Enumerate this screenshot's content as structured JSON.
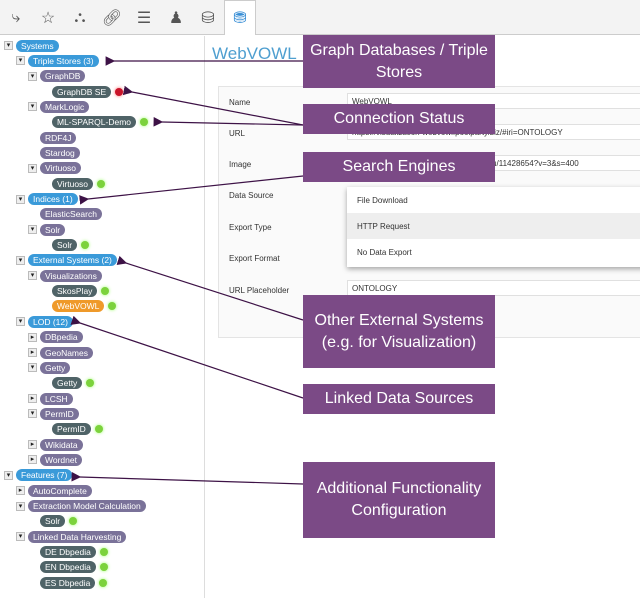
{
  "toolbar": {
    "icons": [
      "hierarchy-icon",
      "document-star-icon",
      "sitemap-icon",
      "link-icon",
      "list-icon",
      "user-settings-icon",
      "database-icon",
      "database-active-icon"
    ]
  },
  "tree": [
    {
      "label": "Systems",
      "level": 0,
      "color": "blue",
      "toggle": "open"
    },
    {
      "label": "Triple Stores (3)",
      "level": 1,
      "color": "blue",
      "toggle": "open"
    },
    {
      "label": "GraphDB",
      "level": 2,
      "color": "purple",
      "toggle": "open"
    },
    {
      "label": "GraphDB SE",
      "level": 3,
      "color": "dark",
      "status": "red"
    },
    {
      "label": "MarkLogic",
      "level": 2,
      "color": "purple",
      "toggle": "open"
    },
    {
      "label": "ML-SPARQL-Demo",
      "level": 3,
      "color": "dark",
      "status": "green"
    },
    {
      "label": "RDF4J",
      "level": 2,
      "color": "purple"
    },
    {
      "label": "Stardog",
      "level": 2,
      "color": "purple"
    },
    {
      "label": "Virtuoso",
      "level": 2,
      "color": "purple",
      "toggle": "open"
    },
    {
      "label": "Virtuoso",
      "level": 3,
      "color": "dark",
      "status": "green"
    },
    {
      "label": "Indices (1)",
      "level": 1,
      "color": "blue",
      "toggle": "open"
    },
    {
      "label": "ElasticSearch",
      "level": 2,
      "color": "purple"
    },
    {
      "label": "Solr",
      "level": 2,
      "color": "purple",
      "toggle": "open"
    },
    {
      "label": "Solr",
      "level": 3,
      "color": "dark",
      "status": "green"
    },
    {
      "label": "External Systems (2)",
      "level": 1,
      "color": "blue",
      "toggle": "open"
    },
    {
      "label": "Visualizations",
      "level": 2,
      "color": "purple",
      "toggle": "open"
    },
    {
      "label": "SkosPlay",
      "level": 3,
      "color": "dark",
      "status": "green"
    },
    {
      "label": "WebVOWL",
      "level": 3,
      "color": "orange",
      "status": "green"
    },
    {
      "label": "LOD (12)",
      "level": 1,
      "color": "blue",
      "toggle": "open"
    },
    {
      "label": "DBpedia",
      "level": 2,
      "color": "purple",
      "toggle": "closed"
    },
    {
      "label": "GeoNames",
      "level": 2,
      "color": "purple",
      "toggle": "closed"
    },
    {
      "label": "Getty",
      "level": 2,
      "color": "purple",
      "toggle": "open"
    },
    {
      "label": "Getty",
      "level": 3,
      "color": "dark",
      "status": "green"
    },
    {
      "label": "LCSH",
      "level": 2,
      "color": "purple",
      "toggle": "closed"
    },
    {
      "label": "PermID",
      "level": 2,
      "color": "purple",
      "toggle": "open"
    },
    {
      "label": "PermID",
      "level": 3,
      "color": "dark",
      "status": "green"
    },
    {
      "label": "Wikidata",
      "level": 2,
      "color": "purple",
      "toggle": "closed"
    },
    {
      "label": "Wordnet",
      "level": 2,
      "color": "purple",
      "toggle": "closed"
    },
    {
      "label": "Features (7)",
      "level": 0,
      "color": "blue",
      "toggle": "open"
    },
    {
      "label": "AutoComplete",
      "level": 1,
      "color": "purple",
      "toggle": "closed"
    },
    {
      "label": "Extraction Model Calculation",
      "level": 1,
      "color": "purple",
      "toggle": "open"
    },
    {
      "label": "Solr",
      "level": 2,
      "color": "dark",
      "status": "green"
    },
    {
      "label": "Linked Data Harvesting",
      "level": 1,
      "color": "purple",
      "toggle": "open"
    },
    {
      "label": "DE Dbpedia",
      "level": 2,
      "color": "dark",
      "status": "green"
    },
    {
      "label": "EN Dbpedia",
      "level": 2,
      "color": "dark",
      "status": "green"
    },
    {
      "label": "ES Dbpedia",
      "level": 2,
      "color": "dark",
      "status": "green"
    }
  ],
  "main": {
    "title": "WebVOWL",
    "fields": [
      {
        "label": "Name",
        "value": "WebVOWL"
      },
      {
        "label": "URL",
        "value": "https://visualization-webvowl.poolparty.biz/#iri=ONTOLOGY"
      },
      {
        "label": "Image",
        "value": "https://avatars1.githubusercontent.com/u/11428654?v=3&s=400"
      },
      {
        "label": "Data Source",
        "value": ""
      },
      {
        "label": "Export Type",
        "value": ""
      },
      {
        "label": "Export Format",
        "value": ""
      },
      {
        "label": "URL Placeholder",
        "value": "ONTOLOGY"
      }
    ],
    "dropdown_options": [
      "File Download",
      "HTTP Request",
      "No Data Export"
    ],
    "dropdown_highlighted": "HTTP Request"
  },
  "annotations": [
    "Graph Databases / Triple Stores",
    "Connection Status",
    "Search Engines",
    "Other External Systems (e.g. for Visualization)",
    "Linked Data Sources",
    "Additional Functionality Configuration"
  ],
  "colors": {
    "annotation": "#7b4a86",
    "blue_node": "#3a9ad9",
    "purple_node": "#7a7299",
    "dark_node": "#4f6367",
    "selected_node": "#ef9a2a",
    "status_ok": "#7cd23c",
    "status_error": "#c9142a"
  }
}
